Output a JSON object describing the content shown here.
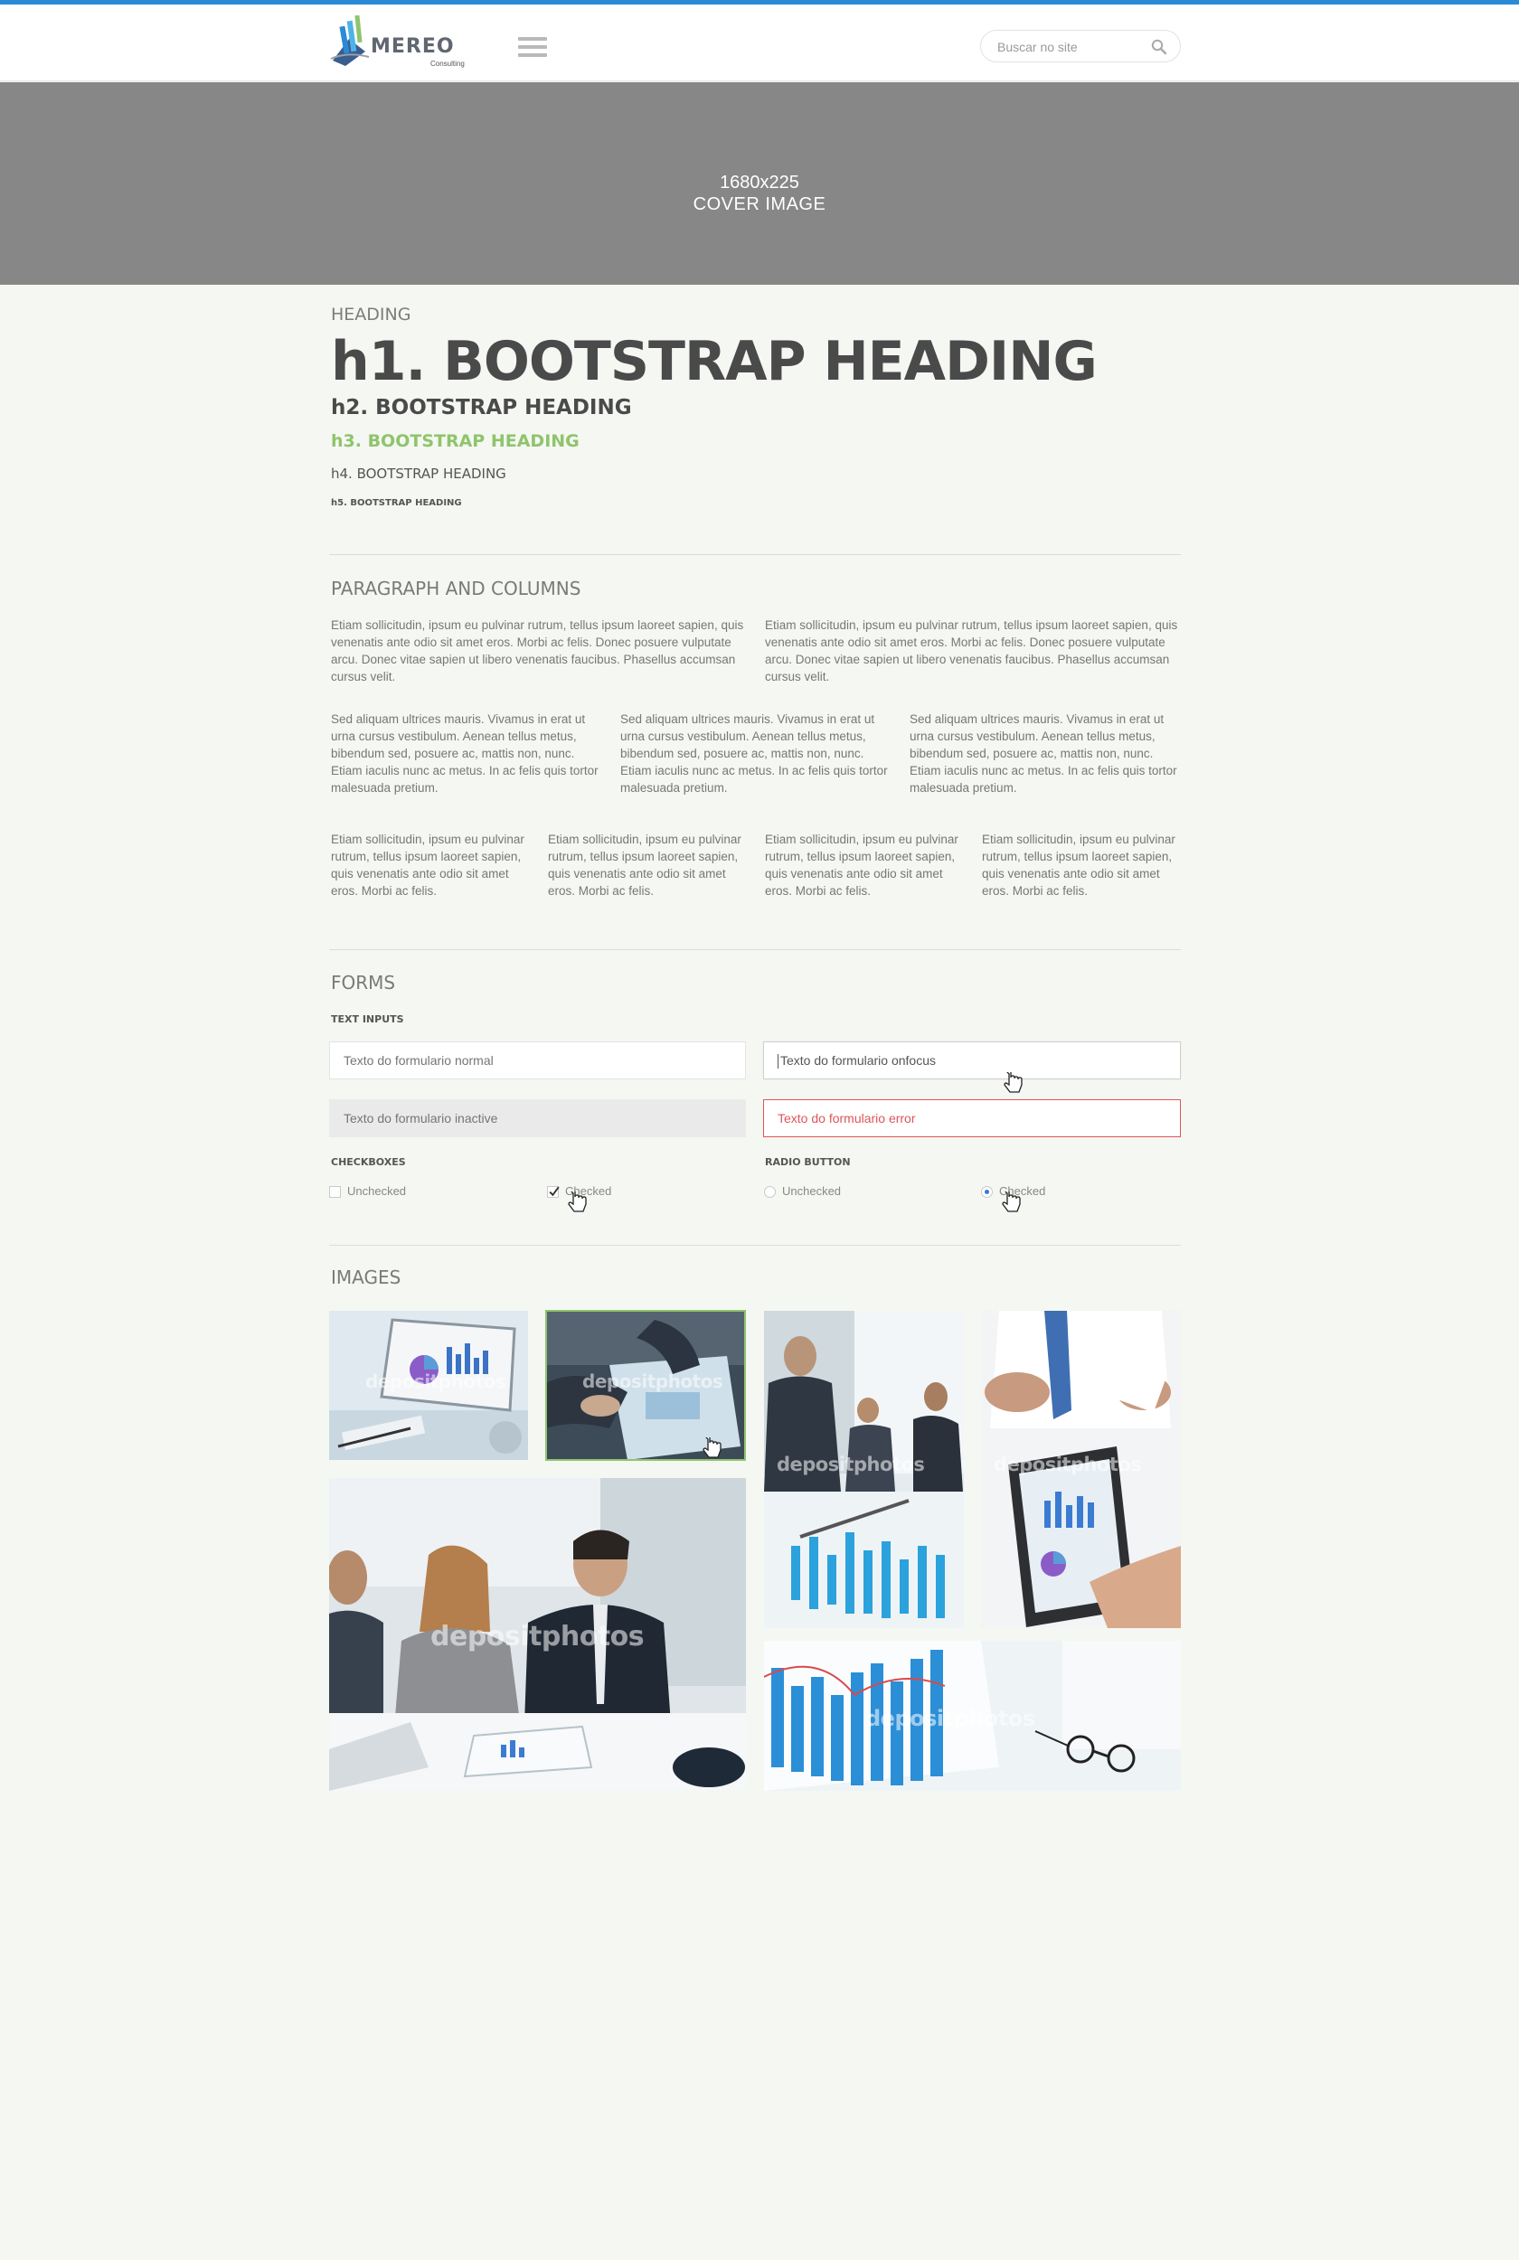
{
  "header": {
    "logo_text": "MEREO",
    "logo_subtext": "Consulting",
    "search_placeholder": "Buscar no site"
  },
  "cover": {
    "line1": "1680x225",
    "line2": "COVER IMAGE"
  },
  "headings": {
    "label": "HEADING",
    "h1": "h1. BOOTSTRAP HEADING",
    "h2": "h2. BOOTSTRAP HEADING",
    "h3": "h3. BOOTSTRAP HEADING",
    "h4": "h4. BOOTSTRAP HEADING",
    "h5": "h5. BOOTSTRAP HEADING"
  },
  "paragraphs": {
    "title": "PARAGRAPH AND COLUMNS",
    "two_col": "Etiam sollicitudin, ipsum eu pulvinar rutrum, tellus ipsum laoreet sapien, quis venenatis ante odio sit amet eros. Morbi ac felis. Donec posuere vulputate arcu. Donec vitae sapien ut libero venenatis faucibus. Phasellus accumsan cursus velit.",
    "three_col": "Sed aliquam ultrices mauris. Vivamus in erat ut urna cursus vestibulum. Aenean tellus metus, bibendum sed, posuere ac, mattis non, nunc. Etiam iaculis nunc ac metus. In ac felis quis tortor malesuada pretium.",
    "four_col": "Etiam sollicitudin, ipsum eu pulvinar rutrum, tellus ipsum laoreet sapien, quis venenatis ante odio sit amet eros. Morbi ac felis."
  },
  "forms": {
    "title": "FORMS",
    "text_inputs_label": "TEXT INPUTS",
    "normal_placeholder": "Texto do formulario normal",
    "focus_value": "Texto do formulario onfocus",
    "inactive_placeholder": "Texto do formulario inactive",
    "error_value": "Texto do formulario error",
    "checkboxes_label": "CHECKBOXES",
    "radio_label": "RADIO BUTTON",
    "unchecked": "Unchecked",
    "checked": "Checked"
  },
  "images": {
    "title": "IMAGES",
    "watermark": "depositphotos"
  },
  "colors": {
    "accent_bar": "#2a8ad6",
    "h3_green": "#8fc46d",
    "error_red": "#e0545a",
    "cover_gray": "#878787",
    "page_bg": "#f5f7f2"
  }
}
